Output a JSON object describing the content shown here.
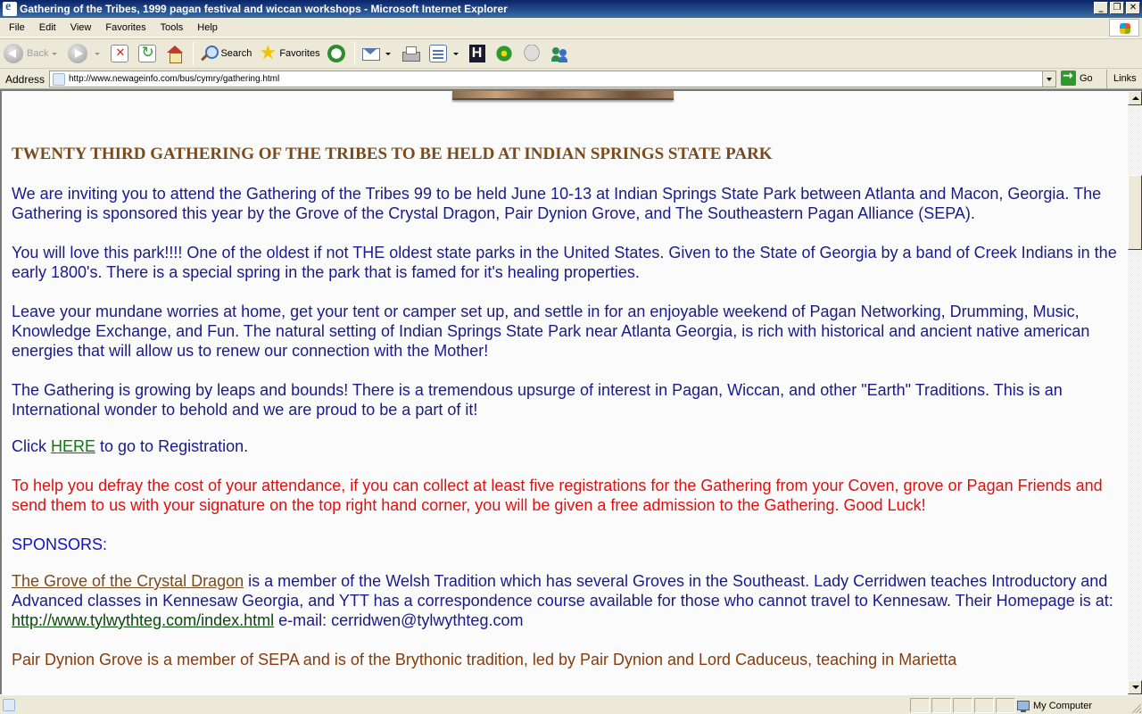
{
  "window": {
    "title": "Gathering of the Tribes, 1999 pagan festival and wiccan workshops - Microsoft Internet Explorer",
    "minimize": "_",
    "restore": "❐",
    "close": "✕"
  },
  "menu": {
    "items": [
      "File",
      "Edit",
      "View",
      "Favorites",
      "Tools",
      "Help"
    ]
  },
  "toolbar": {
    "back_label": "Back",
    "search_label": "Search",
    "favorites_label": "Favorites",
    "h_label": "H"
  },
  "address": {
    "label": "Address",
    "url": "http://www.newageinfo.com/bus/cymry/gathering.html",
    "go_label": "Go",
    "links_label": "Links"
  },
  "page": {
    "heading": "TWENTY THIRD GATHERING OF THE TRIBES TO BE HELD AT INDIAN SPRINGS STATE PARK",
    "p1": "We are inviting you to attend the Gathering of the Tribes 99 to be held June 10-13 at Indian Springs State Park between Atlanta and Macon, Georgia. The Gathering is sponsored this year by the Grove of the Crystal Dragon, Pair Dynion Grove, and The Southeastern Pagan Alliance (SEPA).",
    "p2": "You will love this park!!!! One of the oldest if not THE oldest state parks in the United States. Given to the State of Georgia by a band of Creek Indians in the early 1800's. There is a special spring in the park that is famed for it's healing properties.",
    "p3": "Leave your mundane worries at home, get your tent or camper set up, and settle in for an enjoyable weekend of Pagan Networking, Drumming, Music, Knowledge Exchange, and Fun. The natural setting of Indian Springs State Park near Atlanta Georgia, is rich with historical and ancient native american energies that will allow us to renew our connection with the Mother!",
    "p4": "The Gathering is growing by leaps and bounds! There is a tremendous upsurge of interest in Pagan, Wiccan, and other \"Earth\" Traditions. This is an International wonder to behold and we are proud to be a part of it!",
    "click_prefix": "Click ",
    "here_link": "HERE",
    "click_suffix": " to go to Registration.",
    "red_note": "To help you defray the cost of your attendance, if you can collect at least five registrations for the Gathering from your Coven, grove or Pagan Friends and send them to us with your signature on the top right hand corner, you will be given a free admission to the Gathering.  Good Luck!",
    "sponsors_label": "SPONSORS:",
    "grove_link": "The Grove of the Crystal Dragon",
    "grove_text": " is a member of the Welsh Tradition which has several Groves in the Southeast. Lady Cerridwen teaches Introductory and Advanced classes in Kennesaw Georgia, and YTT has a correspondence course available for those who cannot travel to Kennesaw. Their Homepage is at: ",
    "grove_url": "http://www.tylwythteg.com/index.html",
    "grove_email": "   e-mail: cerridwen@tylwythteg.com",
    "next_partial": "Pair Dynion Grove is a member of SEPA and is of the Brythonic tradition, led by Pair Dynion and Lord Caduceus, teaching in Marietta"
  },
  "scrollbar": {
    "position": 0.14,
    "visible_fraction": 0.13
  },
  "status": {
    "zone_label": "My Computer"
  }
}
